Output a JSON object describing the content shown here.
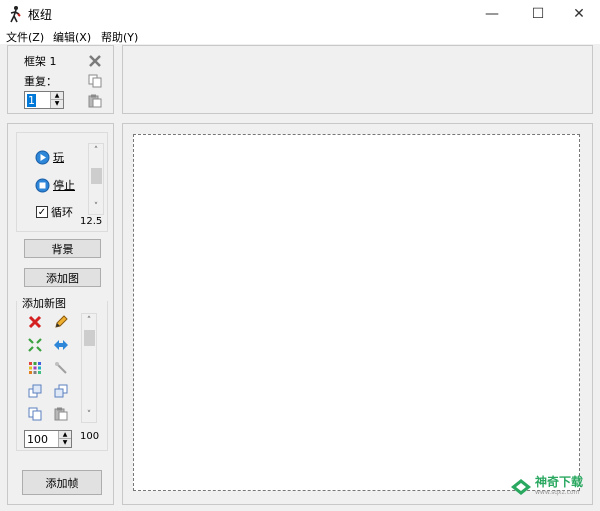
{
  "window": {
    "title": "枢纽",
    "minimize_glyph": "—",
    "maximize_glyph": "☐",
    "close_glyph": "✕"
  },
  "menu": {
    "items": [
      {
        "label": "文件(Z)"
      },
      {
        "label": "编辑(X)"
      },
      {
        "label": "帮助(Y)"
      }
    ]
  },
  "frame_panel": {
    "frame_label": "框架 1",
    "repeat_label": "重复：",
    "repeat_value": "1"
  },
  "playback": {
    "play_label": "玩",
    "stop_label": "停止",
    "loop_label": "循环",
    "loop_checked": true,
    "speed_value": "12.5"
  },
  "buttons": {
    "background_label": "背景",
    "add_image_label": "添加图",
    "add_frame_label": "添加帧"
  },
  "new_image": {
    "group_label": "添加新图",
    "zoom_value": "100",
    "scale_readout": "100"
  },
  "watermark": {
    "text": "神奇下载",
    "subtext": "www.sqxz.com"
  }
}
